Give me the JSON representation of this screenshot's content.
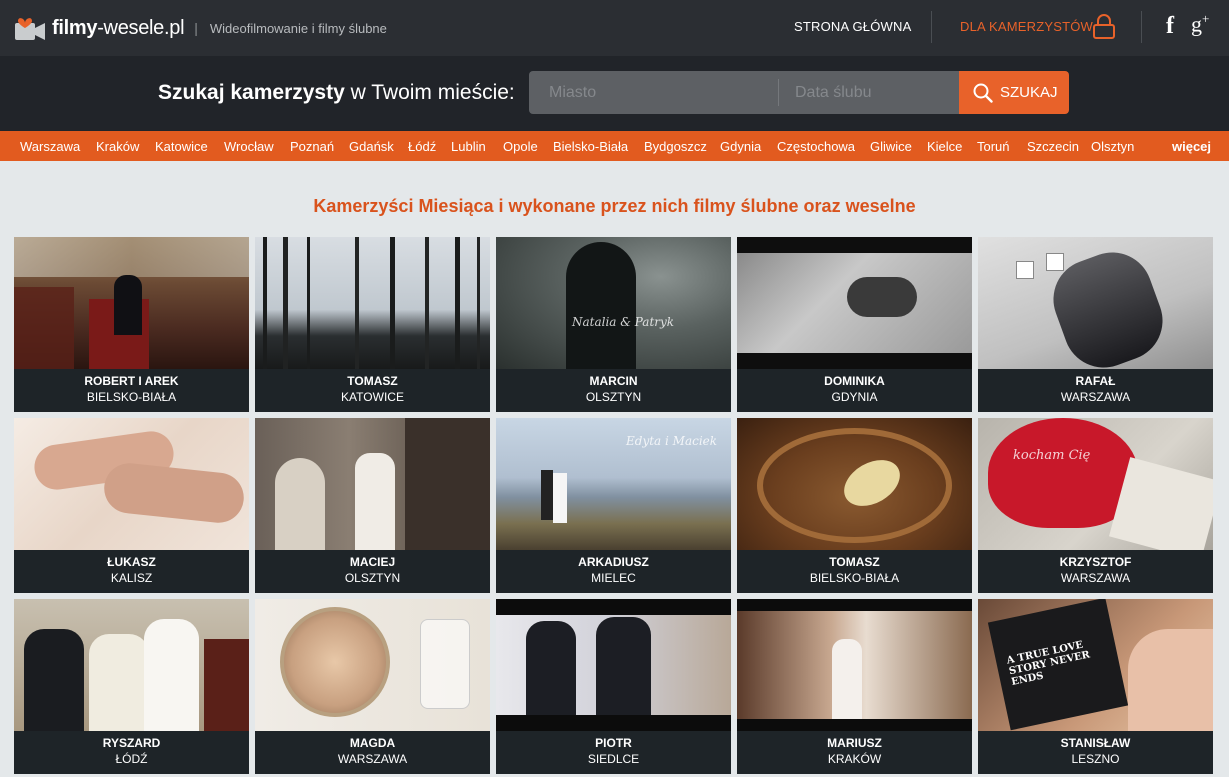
{
  "header": {
    "logo_bold": "filmy",
    "logo_rest": "-wesele.pl",
    "logo_sep": "|",
    "tagline": "Wideofilmowanie i filmy ślubne",
    "nav_home": "STRONA GŁÓWNA",
    "nav_cam": "DLA KAMERZYSTÓW",
    "fb_glyph": "f",
    "gp_glyph": "g",
    "gp_sup": "+"
  },
  "search": {
    "label_bold": "Szukaj kamerzysty",
    "label_rest": " w Twoim mieście:",
    "city_placeholder": "Miasto",
    "date_placeholder": "Data ślubu",
    "button": "SZUKAJ"
  },
  "cities": [
    "Warszawa",
    "Kraków",
    "Katowice",
    "Wrocław",
    "Poznań",
    "Gdańsk",
    "Łódź",
    "Lublin",
    "Opole",
    "Bielsko-Biała",
    "Bydgoszcz",
    "Gdynia",
    "Częstochowa",
    "Gliwice",
    "Kielce",
    "Toruń",
    "Szczecin",
    "Olsztyn"
  ],
  "cities_more": "więcej",
  "headline": "Kamerzyści Miesiąca i wykonane przez nich filmy ślubne oraz weselne",
  "cards": [
    {
      "name": "ROBERT I AREK",
      "city": "BIELSKO-BIAŁA"
    },
    {
      "name": "TOMASZ",
      "city": "KATOWICE"
    },
    {
      "name": "MARCIN",
      "city": "OLSZTYN",
      "script": "Natalia & Patryk"
    },
    {
      "name": "DOMINIKA",
      "city": "GDYNIA"
    },
    {
      "name": "RAFAŁ",
      "city": "WARSZAWA"
    },
    {
      "name": "ŁUKASZ",
      "city": "KALISZ"
    },
    {
      "name": "MACIEJ",
      "city": "OLSZTYN"
    },
    {
      "name": "ARKADIUSZ",
      "city": "MIELEC",
      "script": "Edyta i Maciek"
    },
    {
      "name": "TOMASZ",
      "city": "BIELSKO-BIAŁA"
    },
    {
      "name": "KRZYSZTOF",
      "city": "WARSZAWA",
      "script": "kocham Cię"
    },
    {
      "name": "RYSZARD",
      "city": "ŁÓDŹ"
    },
    {
      "name": "MAGDA",
      "city": "WARSZAWA"
    },
    {
      "name": "PIOTR",
      "city": "SIEDLCE"
    },
    {
      "name": "MARIUSZ",
      "city": "KRAKÓW"
    },
    {
      "name": "STANISŁAW",
      "city": "LESZNO",
      "script": "A TRUE LOVE STORY NEVER ENDS"
    }
  ],
  "colors": {
    "accent": "#e25b1f",
    "topbar": "#2b2e33",
    "searchbar": "#212429",
    "card": "#1e2428"
  }
}
